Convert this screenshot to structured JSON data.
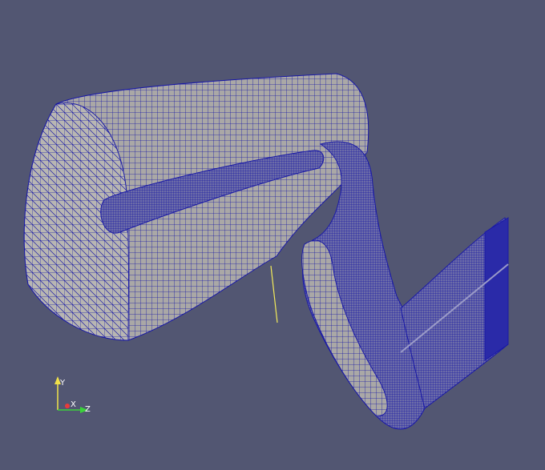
{
  "viewport": {
    "background": "#525672",
    "mesh_edge_color": "#1a1aa6",
    "surface_color": "#b3b1ad",
    "probe_line_color": "#f2ea5a"
  },
  "orientation_axes": {
    "y_label": "Y",
    "x_label": "X",
    "z_label": "Z",
    "y_color": "#f0e04a",
    "x_color": "#e83a3a",
    "z_color": "#3ad23a"
  }
}
